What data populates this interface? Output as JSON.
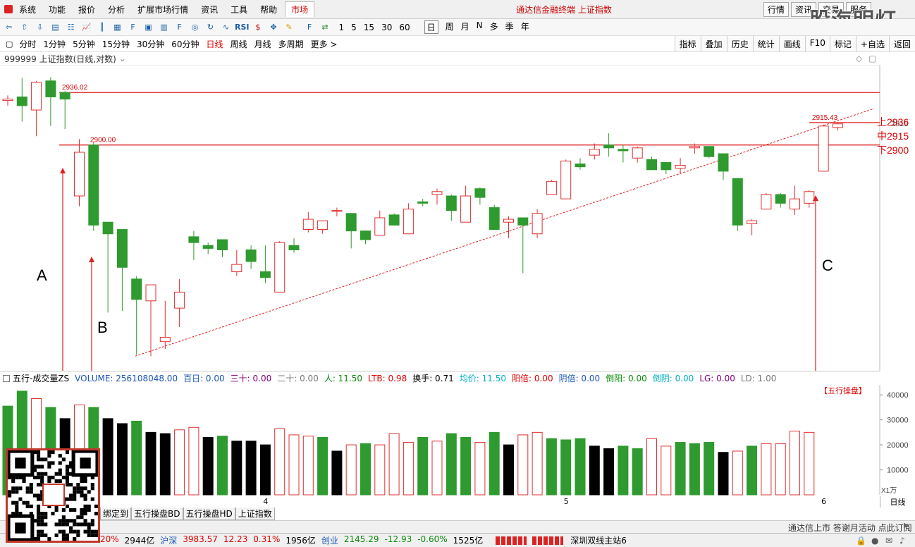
{
  "menu": {
    "items": [
      "系统",
      "功能",
      "报价",
      "分析",
      "扩展市场行情",
      "资讯",
      "工具",
      "帮助"
    ],
    "active_tab": "市场",
    "window_title": "通达信金融终端 上证指数",
    "right_buttons": [
      "行情",
      "资讯",
      "交易",
      "服务"
    ],
    "logo": "股海明灯"
  },
  "toolbar": {
    "periods": [
      "1",
      "5",
      "15",
      "30",
      "60"
    ],
    "day_items": [
      "日",
      "周",
      "月",
      "N",
      "多",
      "季",
      "年"
    ],
    "rsi": "RSI"
  },
  "period_bar": {
    "items": [
      "分时",
      "1分钟",
      "5分钟",
      "15分钟",
      "30分钟",
      "60分钟",
      "日线",
      "周线",
      "月线",
      "多周期",
      "更多 >"
    ],
    "selected": "日线",
    "right_tabs": [
      "指标",
      "叠加",
      "历史",
      "统计",
      "画线",
      "F10",
      "标记",
      "+自选",
      "返回"
    ]
  },
  "chart_header": {
    "title": "999999 上证指数(日线,对数)"
  },
  "price_chart": {
    "lines": [
      {
        "label": "2936.02",
        "value": 2936.02
      },
      {
        "label": "2900.00",
        "value": 2900.0
      }
    ],
    "right_labels": [
      "上2936",
      "中2915",
      "下2900"
    ],
    "axis_label": "2915",
    "last_label": "2915.43",
    "annotations": [
      "A",
      "B",
      "C"
    ],
    "colors": {
      "up": "#e03030",
      "down": "#2f9a2f",
      "line": "#e02020"
    }
  },
  "chart_data": {
    "type": "candlestick",
    "candles": [
      {
        "o": 2930.5,
        "h": 2934.0,
        "l": 2927.0,
        "c": 2931.5
      },
      {
        "o": 2933.0,
        "h": 2946.0,
        "l": 2916.0,
        "c": 2927.0
      },
      {
        "o": 2924.0,
        "h": 2944.0,
        "l": 2906.0,
        "c": 2943.0
      },
      {
        "o": 2944.0,
        "h": 2946.5,
        "l": 2913.0,
        "c": 2933.0
      },
      {
        "o": 2936.0,
        "h": 2937.0,
        "l": 2911.0,
        "c": 2931.5
      },
      {
        "o": 2865.0,
        "h": 2904.0,
        "l": 2858.0,
        "c": 2895.0
      },
      {
        "o": 2900.0,
        "h": 2902.0,
        "l": 2841.0,
        "c": 2845.0
      },
      {
        "o": 2847.0,
        "h": 2829.0,
        "l": 2785.0,
        "c": 2839.0
      },
      {
        "o": 2842.0,
        "h": 2830.0,
        "l": 2786.0,
        "c": 2816.0
      },
      {
        "o": 2808.0,
        "h": 2810.0,
        "l": 2756.0,
        "c": 2794.0
      },
      {
        "o": 2793.0,
        "h": 2798.0,
        "l": 2755.0,
        "c": 2804.0
      },
      {
        "o": 2765.0,
        "h": 2793.0,
        "l": 2760.0,
        "c": 2768.0
      },
      {
        "o": 2788.0,
        "h": 2808.0,
        "l": 2775.0,
        "c": 2799.0
      },
      {
        "o": 2837.0,
        "h": 2841.0,
        "l": 2821.0,
        "c": 2833.0
      },
      {
        "o": 2831.0,
        "h": 2833.0,
        "l": 2825.0,
        "c": 2829.0
      },
      {
        "o": 2835.0,
        "h": 2835.0,
        "l": 2823.0,
        "c": 2828.0
      },
      {
        "o": 2813.0,
        "h": 2828.0,
        "l": 2810.0,
        "c": 2818.0
      },
      {
        "o": 2828.0,
        "h": 2831.0,
        "l": 2815.0,
        "c": 2820.0
      },
      {
        "o": 2813.0,
        "h": 2831.0,
        "l": 2805.0,
        "c": 2809.0
      },
      {
        "o": 2799.0,
        "h": 2834.0,
        "l": 2799.0,
        "c": 2833.0
      },
      {
        "o": 2831.0,
        "h": 2836.0,
        "l": 2826.0,
        "c": 2828.0
      },
      {
        "o": 2842.0,
        "h": 2854.0,
        "l": 2840.0,
        "c": 2849.0
      },
      {
        "o": 2842.0,
        "h": 2848.0,
        "l": 2839.0,
        "c": 2848.0
      },
      {
        "o": 2855.0,
        "h": 2857.0,
        "l": 2851.0,
        "c": 2855.0
      },
      {
        "o": 2853.0,
        "h": 2853.0,
        "l": 2829.0,
        "c": 2841.0
      },
      {
        "o": 2841.0,
        "h": 2837.0,
        "l": 2832.0,
        "c": 2835.0
      },
      {
        "o": 2838.0,
        "h": 2855.0,
        "l": 2838.0,
        "c": 2850.0
      },
      {
        "o": 2852.0,
        "h": 2853.0,
        "l": 2845.0,
        "c": 2845.0
      },
      {
        "o": 2839.0,
        "h": 2860.0,
        "l": 2839.0,
        "c": 2856.0
      },
      {
        "o": 2861.0,
        "h": 2863.0,
        "l": 2858.0,
        "c": 2860.0
      },
      {
        "o": 2866.0,
        "h": 2870.0,
        "l": 2859.0,
        "c": 2868.0
      },
      {
        "o": 2865.0,
        "h": 2866.0,
        "l": 2848.0,
        "c": 2855.0
      },
      {
        "o": 2847.0,
        "h": 2872.0,
        "l": 2847.0,
        "c": 2865.0
      },
      {
        "o": 2870.0,
        "h": 2871.0,
        "l": 2859.0,
        "c": 2864.0
      },
      {
        "o": 2857.0,
        "h": 2859.0,
        "l": 2842.0,
        "c": 2842.0
      },
      {
        "o": 2847.0,
        "h": 2851.0,
        "l": 2836.0,
        "c": 2849.0
      },
      {
        "o": 2850.0,
        "h": 2839.0,
        "l": 2812.0,
        "c": 2845.0
      },
      {
        "o": 2839.0,
        "h": 2856.0,
        "l": 2836.0,
        "c": 2853.0
      },
      {
        "o": 2866.0,
        "h": 2876.0,
        "l": 2866.0,
        "c": 2875.0
      },
      {
        "o": 2863.0,
        "h": 2890.0,
        "l": 2863.0,
        "c": 2889.0
      },
      {
        "o": 2887.0,
        "h": 2891.0,
        "l": 2883.0,
        "c": 2885.0
      },
      {
        "o": 2893.0,
        "h": 2901.0,
        "l": 2890.0,
        "c": 2897.0
      },
      {
        "o": 2900.0,
        "h": 2908.0,
        "l": 2892.0,
        "c": 2898.0
      },
      {
        "o": 2897.0,
        "h": 2900.0,
        "l": 2888.0,
        "c": 2896.0
      },
      {
        "o": 2891.0,
        "h": 2899.0,
        "l": 2888.0,
        "c": 2898.0
      },
      {
        "o": 2890.0,
        "h": 2892.0,
        "l": 2883.0,
        "c": 2883.0
      },
      {
        "o": 2888.0,
        "h": 2888.0,
        "l": 2880.0,
        "c": 2883.0
      },
      {
        "o": 2884.0,
        "h": 2891.0,
        "l": 2880.0,
        "c": 2886.0
      },
      {
        "o": 2898.0,
        "h": 2901.0,
        "l": 2894.0,
        "c": 2899.0
      },
      {
        "o": 2899.0,
        "h": 2899.0,
        "l": 2891.0,
        "c": 2892.0
      },
      {
        "o": 2894.0,
        "h": 2894.0,
        "l": 2876.0,
        "c": 2882.0
      },
      {
        "o": 2877.0,
        "h": 2877.0,
        "l": 2841.0,
        "c": 2845.0
      },
      {
        "o": 2846.0,
        "h": 2849.0,
        "l": 2838.0,
        "c": 2848.0
      },
      {
        "o": 2856.0,
        "h": 2867.0,
        "l": 2856.0,
        "c": 2866.0
      },
      {
        "o": 2866.0,
        "h": 2867.0,
        "l": 2857.0,
        "c": 2860.0
      },
      {
        "o": 2856.0,
        "h": 2872.0,
        "l": 2852.0,
        "c": 2863.0
      },
      {
        "o": 2860.0,
        "h": 2869.0,
        "l": 2857.0,
        "c": 2868.0
      },
      {
        "o": 2882.0,
        "h": 2914.0,
        "l": 2882.0,
        "c": 2913.0
      },
      {
        "o": 2912.0,
        "h": 2915.4,
        "l": 2910.0,
        "c": 2914.5
      }
    ],
    "volume": [
      {
        "v": 35500,
        "c": "down"
      },
      {
        "v": 41500,
        "c": "down"
      },
      {
        "v": 38500,
        "c": "up"
      },
      {
        "v": 35000,
        "c": "down"
      },
      {
        "v": 30500,
        "c": "black"
      },
      {
        "v": 36000,
        "c": "up"
      },
      {
        "v": 35000,
        "c": "down"
      },
      {
        "v": 30500,
        "c": "black"
      },
      {
        "v": 28500,
        "c": "black"
      },
      {
        "v": 29500,
        "c": "down"
      },
      {
        "v": 25000,
        "c": "black"
      },
      {
        "v": 24500,
        "c": "black"
      },
      {
        "v": 26000,
        "c": "up"
      },
      {
        "v": 27000,
        "c": "up"
      },
      {
        "v": 23000,
        "c": "black"
      },
      {
        "v": 23500,
        "c": "down"
      },
      {
        "v": 21500,
        "c": "black"
      },
      {
        "v": 21500,
        "c": "black"
      },
      {
        "v": 20000,
        "c": "black"
      },
      {
        "v": 26500,
        "c": "up"
      },
      {
        "v": 24000,
        "c": "up"
      },
      {
        "v": 23500,
        "c": "up"
      },
      {
        "v": 23000,
        "c": "down"
      },
      {
        "v": 17500,
        "c": "black"
      },
      {
        "v": 20000,
        "c": "up"
      },
      {
        "v": 20500,
        "c": "down"
      },
      {
        "v": 20000,
        "c": "up"
      },
      {
        "v": 24500,
        "c": "up"
      },
      {
        "v": 21000,
        "c": "up"
      },
      {
        "v": 23000,
        "c": "down"
      },
      {
        "v": 21500,
        "c": "up"
      },
      {
        "v": 24500,
        "c": "down"
      },
      {
        "v": 23000,
        "c": "down"
      },
      {
        "v": 21000,
        "c": "up"
      },
      {
        "v": 25000,
        "c": "down"
      },
      {
        "v": 20000,
        "c": "black"
      },
      {
        "v": 24000,
        "c": "up"
      },
      {
        "v": 25000,
        "c": "up"
      },
      {
        "v": 22500,
        "c": "down"
      },
      {
        "v": 22000,
        "c": "down"
      },
      {
        "v": 22500,
        "c": "down"
      },
      {
        "v": 19500,
        "c": "black"
      },
      {
        "v": 18500,
        "c": "black"
      },
      {
        "v": 19500,
        "c": "down"
      },
      {
        "v": 18500,
        "c": "down"
      },
      {
        "v": 22500,
        "c": "up"
      },
      {
        "v": 19500,
        "c": "up"
      },
      {
        "v": 21000,
        "c": "down"
      },
      {
        "v": 20500,
        "c": "down"
      },
      {
        "v": 21000,
        "c": "down"
      },
      {
        "v": 17000,
        "c": "black"
      },
      {
        "v": 17500,
        "c": "up"
      },
      {
        "v": 19500,
        "c": "down"
      },
      {
        "v": 20500,
        "c": "up"
      },
      {
        "v": 20500,
        "c": "up"
      },
      {
        "v": 25500,
        "c": "up"
      },
      {
        "v": 25000,
        "c": "up"
      }
    ],
    "volume_axis": {
      "ticks": [
        10000,
        20000,
        30000,
        40000
      ],
      "label": "X1万"
    },
    "date_ticks": [
      {
        "i": 18,
        "label": "4"
      },
      {
        "i": 39,
        "label": "5"
      },
      {
        "i": 57,
        "label": "6"
      }
    ]
  },
  "vol_header": [
    {
      "t": "五行-成交量ZS",
      "cls": ""
    },
    {
      "t": "VOLUME: 256108048.00",
      "cls": "blu"
    },
    {
      "t": "百日: 0.00",
      "cls": "blu"
    },
    {
      "t": "三十: 0.00",
      "cls": "pur"
    },
    {
      "t": "二十: 0.00",
      "cls": "gry"
    },
    {
      "t": "人: 11.50",
      "cls": "grn"
    },
    {
      "t": "LTB: 0.98",
      "cls": "red"
    },
    {
      "t": "换手: 0.71",
      "cls": ""
    },
    {
      "t": "均价: 11.50",
      "cls": "cy"
    },
    {
      "t": "阳倍: 0.00",
      "cls": "red"
    },
    {
      "t": "阴倍: 0.00",
      "cls": "blu"
    },
    {
      "t": "倒阳: 0.00",
      "cls": "grn"
    },
    {
      "t": "倒阴: 0.00",
      "cls": "cy"
    },
    {
      "t": "LG: 0.00",
      "cls": "pur"
    },
    {
      "t": "LD: 1.00",
      "cls": "gry"
    }
  ],
  "vol_marker": "【五行操盘】",
  "bottom_tabs": [
    "绑定到",
    "五行操盘BD",
    "五行操盘HD",
    "上证指数"
  ],
  "period_label": "日线",
  "scroll_text": "通达信上市 答谢月活动 点此订阅",
  "status": {
    "items": [
      {
        "t": "20%",
        "cls": "red"
      },
      {
        "t": "2944亿",
        "cls": ""
      },
      {
        "t": "沪深",
        "cls": "blu"
      },
      {
        "t": "3983.57",
        "cls": "red"
      },
      {
        "t": "12.23",
        "cls": "red"
      },
      {
        "t": "0.31%",
        "cls": "red"
      },
      {
        "t": "1956亿",
        "cls": ""
      },
      {
        "t": "创业",
        "cls": "blu"
      },
      {
        "t": "2145.29",
        "cls": "grn"
      },
      {
        "t": "-12.93",
        "cls": "grn"
      },
      {
        "t": "-0.60%",
        "cls": "grn"
      },
      {
        "t": "1525亿",
        "cls": ""
      }
    ],
    "server": "深圳双线主站6"
  }
}
